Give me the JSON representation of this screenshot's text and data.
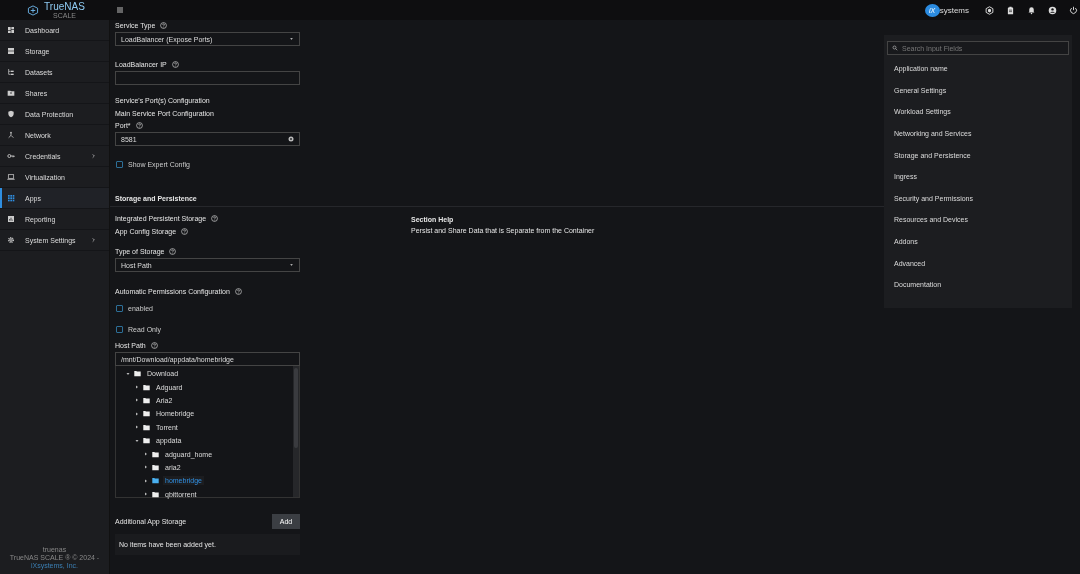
{
  "header": {
    "logo_text": "TrueNAS",
    "logo_subtext": "SCALE",
    "brand_mark": "iX",
    "brand_text": "systems"
  },
  "sidebar": {
    "items": [
      {
        "label": "Dashboard",
        "selected": false,
        "has_submenu": false
      },
      {
        "label": "Storage",
        "selected": false,
        "has_submenu": false
      },
      {
        "label": "Datasets",
        "selected": false,
        "has_submenu": false
      },
      {
        "label": "Shares",
        "selected": false,
        "has_submenu": false
      },
      {
        "label": "Data Protection",
        "selected": false,
        "has_submenu": false
      },
      {
        "label": "Network",
        "selected": false,
        "has_submenu": false
      },
      {
        "label": "Credentials",
        "selected": false,
        "has_submenu": true
      },
      {
        "label": "Virtualization",
        "selected": false,
        "has_submenu": false
      },
      {
        "label": "Apps",
        "selected": true,
        "has_submenu": false
      },
      {
        "label": "Reporting",
        "selected": false,
        "has_submenu": false
      },
      {
        "label": "System Settings",
        "selected": false,
        "has_submenu": true
      }
    ],
    "footer": {
      "hostname": "truenas",
      "copyright": "TrueNAS SCALE ® © 2024 -",
      "company": "iXsystems, Inc."
    }
  },
  "form": {
    "sections": [
      {
        "items": [
          {
            "kind": "select",
            "label": "Service Type",
            "help": true,
            "value": "LoadBalancer (Expose Ports)"
          },
          {
            "kind": "input",
            "label": "LoadBalancer IP",
            "help": true
          },
          {
            "kind": "text",
            "text": "Service's Port(s) Configuration"
          },
          {
            "kind": "text",
            "text": "Main Service Port Configuration"
          },
          {
            "kind": "input",
            "label": "Port*",
            "help": true,
            "value": "8581",
            "clearable": true
          },
          {
            "kind": "checkbox",
            "label": "Show Expert Config",
            "checked": false
          }
        ]
      },
      {
        "title": "Storage and Persistence",
        "help_title": "Section Help",
        "help_text": "Persist and Share Data that is Separate from the Container",
        "items": [
          {
            "kind": "text",
            "text": "Integrated Persistent Storage",
            "help": true
          },
          {
            "kind": "text",
            "text": "App Config Storage",
            "help": true
          },
          {
            "kind": "select",
            "label": "Type of Storage",
            "help": true,
            "value": "Host Path"
          },
          {
            "kind": "text",
            "text": "Automatic Permissions Configuration",
            "help": true
          },
          {
            "kind": "checkbox",
            "label": "enabled",
            "checked": false
          },
          {
            "kind": "checkbox",
            "label": "Read Only",
            "checked": false
          },
          {
            "kind": "path",
            "label": "Host Path",
            "help": true,
            "value": "/mnt/Download/appdata/homebridge",
            "tree": [
              {
                "name": "Download",
                "expanded": true,
                "selected": false,
                "children": [
                  {
                    "name": "Adguard",
                    "expanded": false,
                    "selected": false
                  },
                  {
                    "name": "Aria2",
                    "expanded": false,
                    "selected": false
                  },
                  {
                    "name": "Homebridge",
                    "expanded": false,
                    "selected": false
                  },
                  {
                    "name": "Torrent",
                    "expanded": false,
                    "selected": false
                  },
                  {
                    "name": "appdata",
                    "expanded": true,
                    "selected": false,
                    "children": [
                      {
                        "name": "adguard_home",
                        "expanded": false,
                        "selected": false
                      },
                      {
                        "name": "aria2",
                        "expanded": false,
                        "selected": false
                      },
                      {
                        "name": "homebridge",
                        "expanded": false,
                        "selected": true
                      },
                      {
                        "name": "qbittorrent",
                        "expanded": false,
                        "selected": false
                      }
                    ]
                  }
                ]
              }
            ]
          },
          {
            "kind": "list",
            "label": "Additional App Storage",
            "button": "Add",
            "empty_text": "No items have been added yet."
          }
        ]
      }
    ]
  },
  "help_panel": {
    "search_placeholder": "Search Input Fields",
    "links": [
      "Application name",
      "General Settings",
      "Workload Settings",
      "Networking and Services",
      "Storage and Persistence",
      "Ingress",
      "Security and Permissions",
      "Resources and Devices",
      "Addons",
      "Advanced",
      "Documentation"
    ]
  }
}
